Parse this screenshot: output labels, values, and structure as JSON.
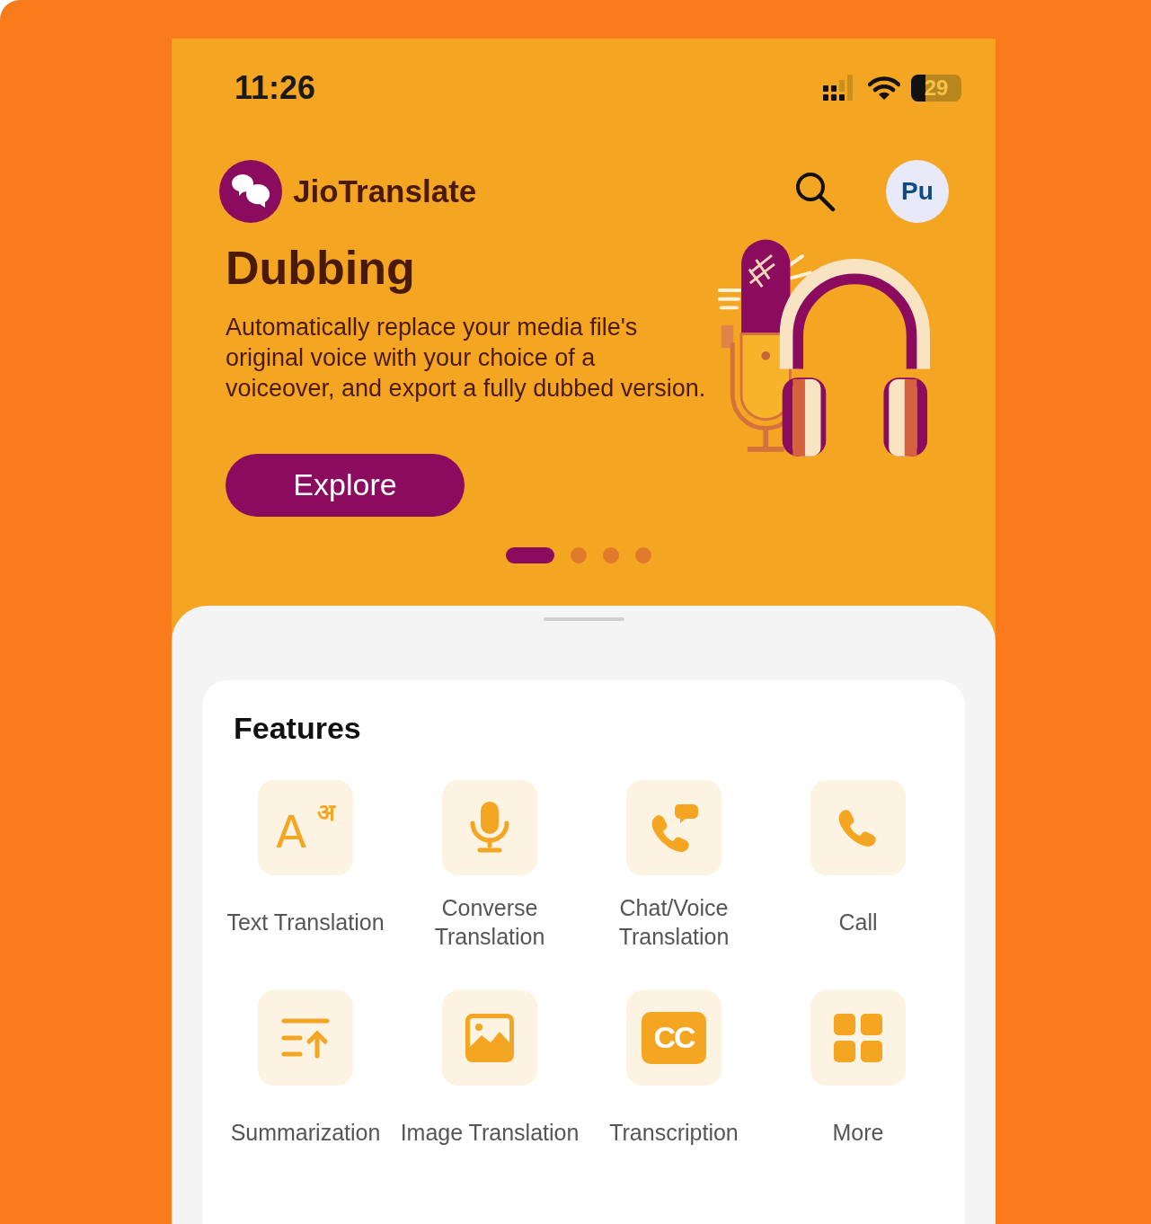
{
  "status_bar": {
    "time": "11:26",
    "battery": "29"
  },
  "header": {
    "app_name": "JioTranslate",
    "avatar": "Pu"
  },
  "banner": {
    "title": "Dubbing",
    "description": "Automatically replace your media file's original voice with your choice of a voiceover, and export a fully dubbed version.",
    "button": "Explore"
  },
  "carousel_dots": [
    {
      "selected": true
    },
    {
      "selected": false
    },
    {
      "selected": false
    },
    {
      "selected": false
    }
  ],
  "features": {
    "title": "Features",
    "items": [
      {
        "kind": "text",
        "label": "Text Translation",
        "glyphs": [
          "A",
          "अ"
        ]
      },
      {
        "kind": "mic",
        "label": "Converse Translation"
      },
      {
        "kind": "chat-call",
        "label": "Chat/Voice Translation"
      },
      {
        "kind": "call",
        "label": "Call"
      },
      {
        "kind": "summary",
        "label": "Summarization"
      },
      {
        "kind": "image",
        "label": "Image Translation"
      },
      {
        "kind": "cc",
        "label": "Transcription",
        "glyph": "CC"
      },
      {
        "kind": "more",
        "label": "More"
      }
    ]
  }
}
